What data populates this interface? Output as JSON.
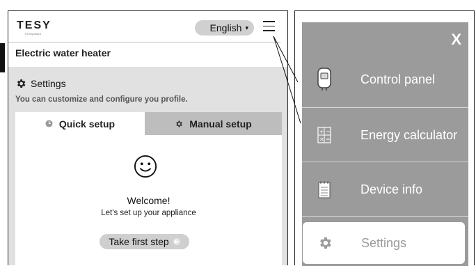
{
  "header": {
    "logo_text": "TESY",
    "logo_tag": "It's important",
    "language_label": "English"
  },
  "app": {
    "title": "Electric water heater"
  },
  "settings": {
    "title": "Settings",
    "description": "You can customize and configure you profile."
  },
  "tabs": {
    "quick": "Quick setup",
    "manual": "Manual setup"
  },
  "welcome": {
    "title": "Welcome!",
    "subtitle": "Let's set up your appliance",
    "button": "Take first step"
  },
  "menu": {
    "close_label": "X",
    "items": [
      {
        "label": "Control panel",
        "icon": "water-heater-icon"
      },
      {
        "label": "Energy calculator",
        "icon": "calculator-icon"
      },
      {
        "label": "Device info",
        "icon": "notepad-icon"
      },
      {
        "label": "Settings",
        "icon": "gear-icon"
      }
    ]
  },
  "colors": {
    "menu_bg": "#9b9b9b",
    "grey_area": "#e1e1e1",
    "active_tab": "#bdbdbd"
  }
}
